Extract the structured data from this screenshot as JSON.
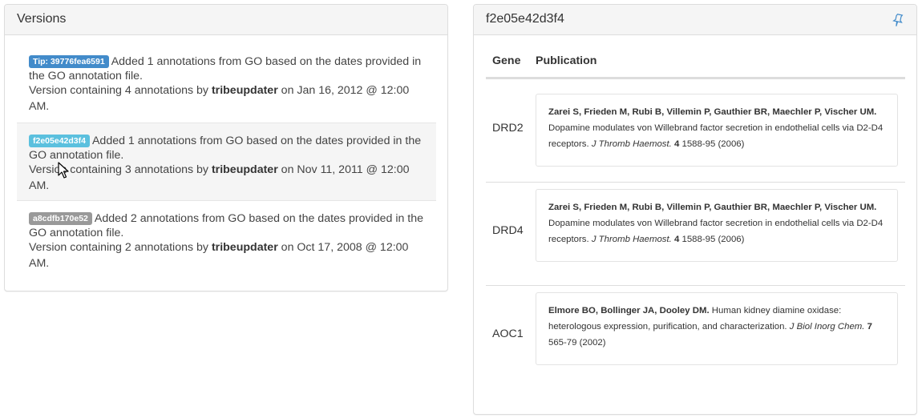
{
  "versions_panel": {
    "title": "Versions",
    "items": [
      {
        "badge": "Tip: 39776fea6591",
        "badge_color": "#428bca",
        "description": "Added 1 annotations from GO based on the dates provided in the GO annotation file.",
        "info_prefix": "Version containing 4 annotations by ",
        "user": "tribeupdater",
        "info_suffix": " on Jan 16, 2012 @ 12:00 AM.",
        "active": false
      },
      {
        "badge": "f2e05e42d3f4",
        "badge_color": "#5bc0de",
        "description": "Added 1 annotations from GO based on the dates provided in the GO annotation file.",
        "info_prefix": "Version containing 3 annotations by ",
        "user": "tribeupdater",
        "info_suffix": " on Nov 11, 2011 @ 12:00 AM.",
        "active": true
      },
      {
        "badge": "a8cdfb170e52",
        "badge_color": "#999999",
        "description": "Added 2 annotations from GO based on the dates provided in the GO annotation file.",
        "info_prefix": "Version containing 2 annotations by ",
        "user": "tribeupdater",
        "info_suffix": " on Oct 17, 2008 @ 12:00 AM.",
        "active": false
      }
    ]
  },
  "detail_panel": {
    "title": "f2e05e42d3f4",
    "icon": "pushpin-icon",
    "columns": {
      "gene": "Gene",
      "publication": "Publication"
    },
    "rows": [
      {
        "gene": "DRD2",
        "authors": "Zarei S, Frieden M, Rubi B, Villemin P, Gauthier BR, Maechler P, Vischer UM.",
        "title": " Dopamine modulates von Willebrand factor secretion in endothelial cells via D2-D4 receptors. ",
        "journal": "J Thromb Haemost.",
        "volume": "4",
        "pages": " 1588-95 (2006)"
      },
      {
        "gene": "DRD4",
        "authors": "Zarei S, Frieden M, Rubi B, Villemin P, Gauthier BR, Maechler P, Vischer UM.",
        "title": " Dopamine modulates von Willebrand factor secretion in endothelial cells via D2-D4 receptors. ",
        "journal": "J Thromb Haemost.",
        "volume": "4",
        "pages": " 1588-95 (2006)"
      },
      {
        "gene": "AOC1",
        "authors": "Elmore BO, Bollinger JA, Dooley DM.",
        "title": " Human kidney diamine oxidase: heterologous expression, purification, and characterization. ",
        "journal": "J Biol Inorg Chem.",
        "volume": "7",
        "pages": " 565-79 (2002)"
      }
    ]
  },
  "colors": {
    "link": "#428bca",
    "panel_heading": "#f5f5f5",
    "border": "#dddddd"
  }
}
